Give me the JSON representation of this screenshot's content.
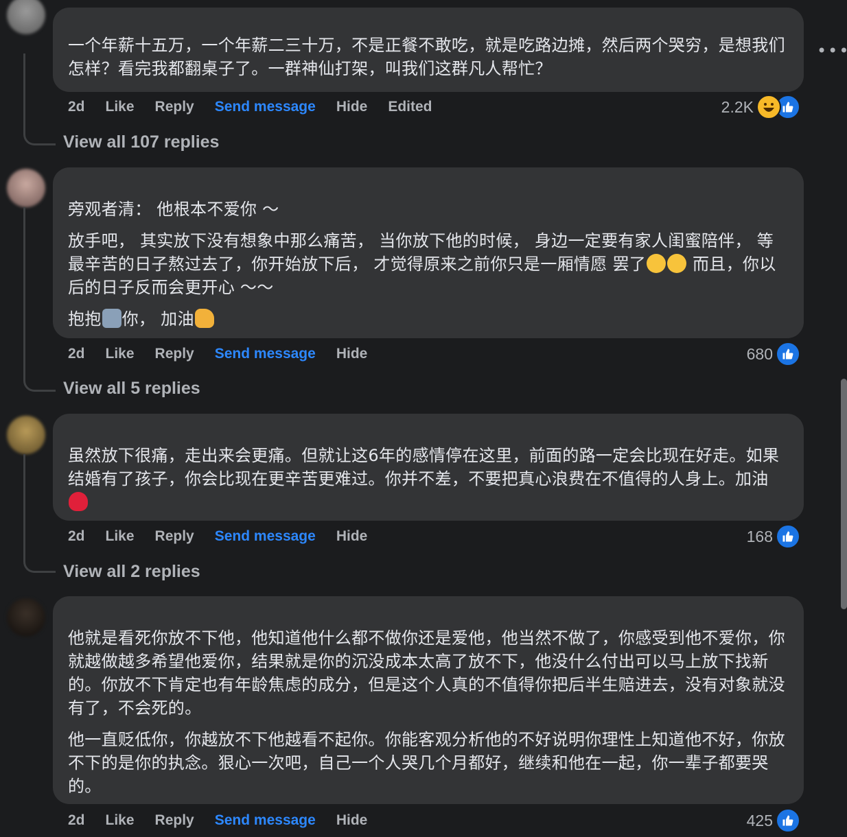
{
  "comments": [
    {
      "paragraphs": [
        "一个年薪十五万，一个年薪二三十万，不是正餐不敢吃，就是吃路边摊，然后两个哭穷，是想我们怎样？看完我都翻桌子了。一群神仙打架，叫我们这群凡人帮忙？"
      ],
      "time": "2d",
      "like": "Like",
      "reply": "Reply",
      "send": "Send message",
      "hide": "Hide",
      "edited": "Edited",
      "reaction_count": "2.2K",
      "view_replies": "View all 107 replies"
    },
    {
      "paragraphs": [
        "旁观者清： 他根本不爱你 ～",
        "放手吧， 其实放下没有想象中那么痛苦， 当你放下他的时候， 身边一定要有家人闺蜜陪伴， 等最辛苦的日子熬过去了，你开始放下后， 才觉得原来之前你只是一厢情愿 罢了",
        "而且，你以后的日子反而会更开心 ～～",
        "抱抱",
        "你， 加油"
      ],
      "time": "2d",
      "like": "Like",
      "reply": "Reply",
      "send": "Send message",
      "hide": "Hide",
      "reaction_count": "680",
      "view_replies": "View all 5 replies"
    },
    {
      "paragraphs": [
        "虽然放下很痛，走出来会更痛。但就让这6年的感情停在这里，前面的路一定会比现在好走。如果结婚有了孩子，你会比现在更辛苦更难过。你并不差，不要把真心浪费在不值得的人身上。加油"
      ],
      "time": "2d",
      "like": "Like",
      "reply": "Reply",
      "send": "Send message",
      "hide": "Hide",
      "reaction_count": "168",
      "view_replies": "View all 2 replies"
    },
    {
      "paragraphs": [
        "他就是看死你放不下他，他知道他什么都不做你还是爱他，他当然不做了，你感受到他不爱你，你就越做越多希望他爱你，结果就是你的沉没成本太高了放不下，他没什么付出可以马上放下找新的。你放不下肯定也有年龄焦虑的成分，但是这个人真的不值得你把后半生赔进去，没有对象就没有了，不会死的。",
        "他一直贬低你，你越放不下他越看不起你。你能客观分析他的不好说明你理性上知道他不好，你放不下的是你的执念。狠心一次吧，自己一个人哭几个月都好，继续和他在一起，你一辈子都要哭的。"
      ],
      "time": "2d",
      "like": "Like",
      "reply": "Reply",
      "send": "Send message",
      "hide": "Hide",
      "reaction_count": "425"
    }
  ],
  "more_menu": "•••",
  "icons": {
    "like": "thumbs-up-icon",
    "haha": "haha-emoji-icon",
    "more": "more-options-icon"
  },
  "colors": {
    "accent": "#2d88ff",
    "like_blue": "#1b74e4"
  }
}
